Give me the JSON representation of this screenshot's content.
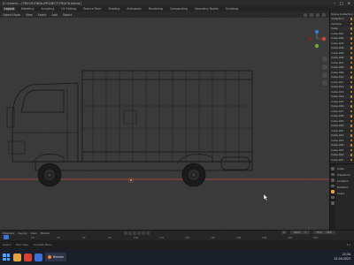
{
  "window": {
    "title": "[C:\\Users\\...\\TRUCK\\FINAL\\PROJECT\\TRUCK.blend]",
    "controls": [
      "–",
      "□",
      "✕"
    ]
  },
  "menubar": {
    "workspaces": [
      {
        "label": "Layout",
        "active": true
      },
      {
        "label": "Modeling",
        "active": false
      },
      {
        "label": "Sculpting",
        "active": false
      },
      {
        "label": "UV Editing",
        "active": false
      },
      {
        "label": "Texture Paint",
        "active": false
      },
      {
        "label": "Shading",
        "active": false
      },
      {
        "label": "Animation",
        "active": false
      },
      {
        "label": "Rendering",
        "active": false
      },
      {
        "label": "Compositing",
        "active": false
      },
      {
        "label": "Geometry Nodes",
        "active": false
      },
      {
        "label": "Scripting",
        "active": false
      }
    ]
  },
  "viewport_header": {
    "items": [
      "Object Mode",
      "View",
      "Select",
      "Add",
      "Object"
    ]
  },
  "outliner": {
    "rows": [
      "Scene Collection",
      "Collection",
      "Camera",
      "Cube",
      "Cube.001",
      "Cube.002",
      "Cube.003",
      "Cube.004",
      "Cube.005",
      "Cube.006",
      "Cube.007",
      "Cube.008",
      "Cube.009",
      "Cube.010",
      "Cube.011",
      "Cube.012",
      "Cube.013",
      "Cube.014",
      "Cube.015",
      "Cube.016",
      "Cube.017",
      "Cube.018",
      "Cube.019",
      "Cube.020",
      "Cube.021",
      "Cube.022",
      "Cube.023",
      "Cube.024",
      "Cube.025",
      "Cube.026",
      "Cube.027"
    ],
    "accent": "#cf8f2e"
  },
  "properties": {
    "fields": [
      "Cube",
      "Transform",
      "Location",
      "Rotation",
      "Scale"
    ],
    "accent": "#e8a23c"
  },
  "timeline": {
    "menus": [
      "Playback",
      "Keying",
      "View",
      "Marker"
    ],
    "start_label": "Start",
    "start": "1",
    "end_label": "End",
    "end": "250",
    "current": "1",
    "ruler": [
      "0",
      "20",
      "40",
      "60",
      "80",
      "100",
      "120",
      "140",
      "160",
      "180",
      "200",
      "220",
      "240"
    ]
  },
  "statusbar": {
    "left": [
      "Select",
      "Pan View",
      "Context Menu"
    ],
    "version": "3.x"
  },
  "taskbar": {
    "task_label": "Blender",
    "time": "21:34",
    "date": "22-04-2023"
  },
  "colors": {
    "viewport_bg": "#3a3a3a",
    "x_axis": "#b8453c",
    "selection_accent": "#e8a23c",
    "active_blue": "#3c6fd8"
  }
}
